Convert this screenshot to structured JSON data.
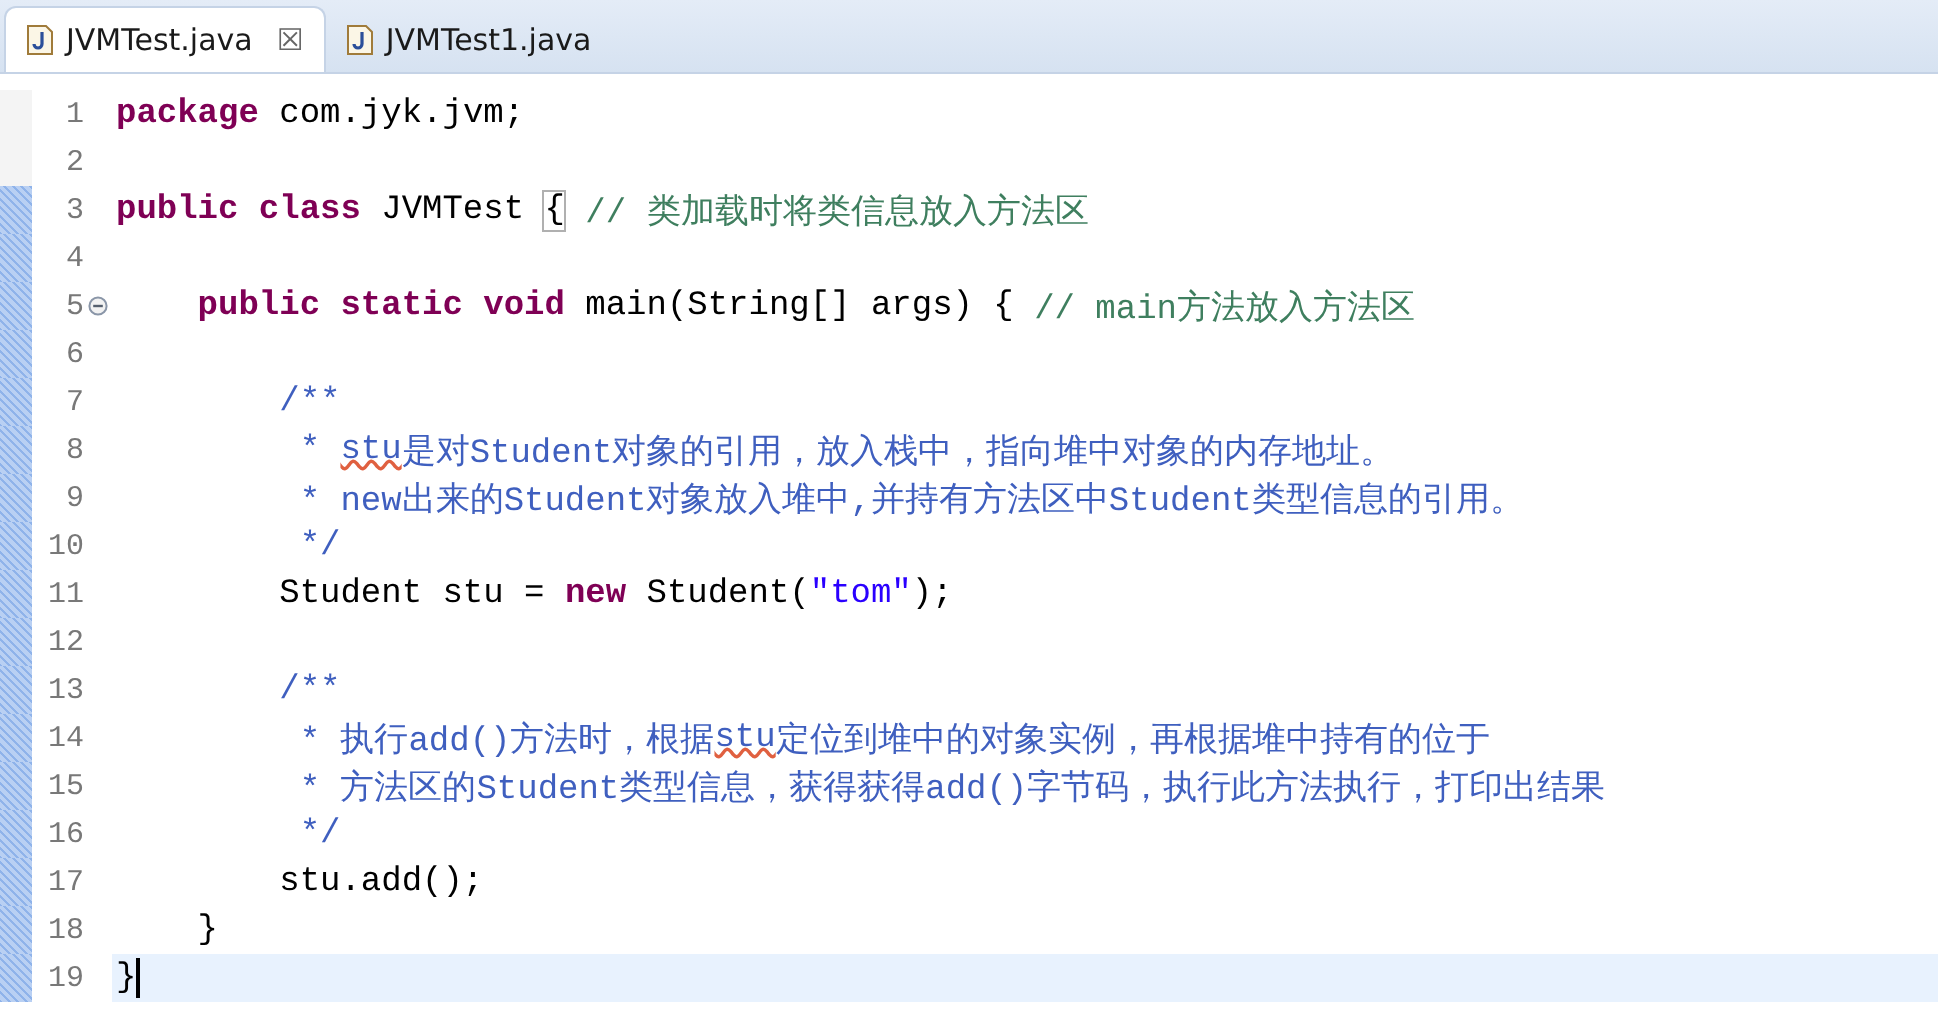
{
  "tabs": [
    {
      "label": "JVMTest.java",
      "selected": true,
      "close": "☒"
    },
    {
      "label": "JVMTest1.java",
      "selected": false
    }
  ],
  "lines": [
    {
      "number": "1",
      "changed": false,
      "current": false,
      "tokens": [
        {
          "kind": "keyword",
          "text": "package"
        },
        {
          "kind": "plain",
          "text": " com.jyk.jvm;"
        }
      ]
    },
    {
      "number": "2",
      "changed": false,
      "current": false
    },
    {
      "number": "3",
      "changed": true,
      "current": false,
      "tokens": [
        {
          "kind": "keyword",
          "text": "public class"
        },
        {
          "kind": "plain",
          "text": " JVMTest "
        },
        {
          "kind": "bracket",
          "text": "{"
        },
        {
          "kind": "comment",
          "text": " // 类加载时将类信息放入方法区"
        }
      ]
    },
    {
      "number": "4",
      "changed": true,
      "current": false
    },
    {
      "number": "5",
      "changed": true,
      "current": false,
      "foldable": true,
      "tokens": [
        {
          "kind": "keyword",
          "text": "    public static void"
        },
        {
          "kind": "plain",
          "text": " main(String[] args) { "
        },
        {
          "kind": "comment",
          "text": "// main方法放入方法区"
        }
      ]
    },
    {
      "number": "6",
      "changed": true,
      "current": false
    },
    {
      "number": "7",
      "changed": true,
      "current": false,
      "tokens": [
        {
          "kind": "javadoc",
          "text": "        /**"
        }
      ]
    },
    {
      "number": "8",
      "changed": true,
      "current": false,
      "tokens": [
        {
          "kind": "javadoc",
          "text": "         * "
        },
        {
          "kind": "javadoc",
          "text": "stu",
          "warning": true
        },
        {
          "kind": "javadoc",
          "text": "是对Student对象的引用，放入栈中，指向堆中对象的内存地址。"
        }
      ]
    },
    {
      "number": "9",
      "changed": true,
      "current": false,
      "tokens": [
        {
          "kind": "javadoc",
          "text": "         * new出来的Student对象放入堆中,并持有方法区中Student类型信息的引用。"
        }
      ]
    },
    {
      "number": "10",
      "changed": true,
      "current": false,
      "tokens": [
        {
          "kind": "javadoc",
          "text": "         */"
        }
      ]
    },
    {
      "number": "11",
      "changed": true,
      "current": false,
      "tokens": [
        {
          "kind": "plain",
          "text": "        Student stu = "
        },
        {
          "kind": "keyword",
          "text": "new"
        },
        {
          "kind": "plain",
          "text": " Student("
        },
        {
          "kind": "string",
          "text": "\"tom\""
        },
        {
          "kind": "plain",
          "text": ");"
        }
      ]
    },
    {
      "number": "12",
      "changed": true,
      "current": false
    },
    {
      "number": "13",
      "changed": true,
      "current": false,
      "tokens": [
        {
          "kind": "javadoc",
          "text": "        /**"
        }
      ]
    },
    {
      "number": "14",
      "changed": true,
      "current": false,
      "tokens": [
        {
          "kind": "javadoc",
          "text": "         * 执行add()方法时，根据"
        },
        {
          "kind": "javadoc",
          "text": "stu",
          "warning": true
        },
        {
          "kind": "javadoc",
          "text": "定位到堆中的对象实例，再根据堆中持有的位于"
        }
      ]
    },
    {
      "number": "15",
      "changed": true,
      "current": false,
      "tokens": [
        {
          "kind": "javadoc",
          "text": "         * 方法区的Student类型信息，获得获得add()字节码，执行此方法执行，打印出结果"
        }
      ]
    },
    {
      "number": "16",
      "changed": true,
      "current": false,
      "tokens": [
        {
          "kind": "javadoc",
          "text": "         */"
        }
      ]
    },
    {
      "number": "17",
      "changed": true,
      "current": false,
      "tokens": [
        {
          "kind": "plain",
          "text": "        stu.add();"
        }
      ]
    },
    {
      "number": "18",
      "changed": true,
      "current": false,
      "tokens": [
        {
          "kind": "plain",
          "text": "    }"
        }
      ]
    },
    {
      "number": "19",
      "changed": true,
      "current": true,
      "tokens": [
        {
          "kind": "plain",
          "text": "}"
        }
      ]
    }
  ]
}
